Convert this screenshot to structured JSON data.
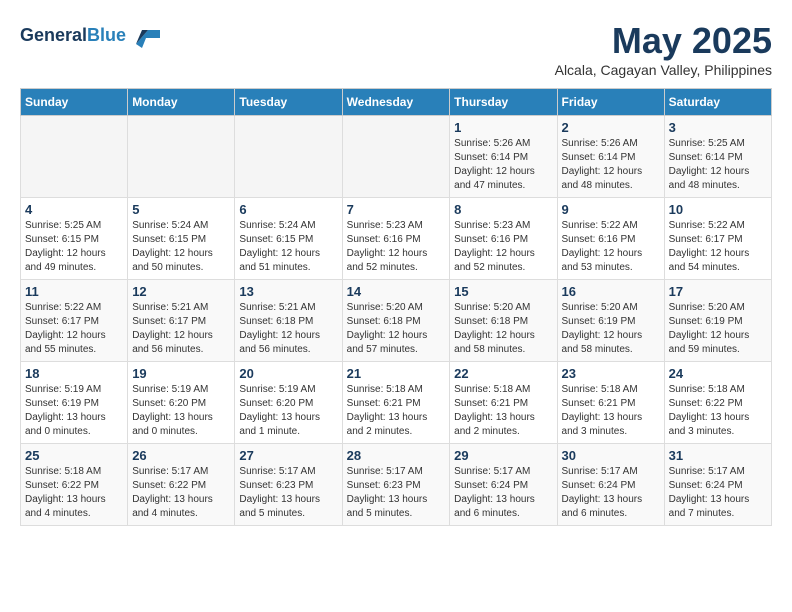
{
  "header": {
    "logo_line1": "General",
    "logo_line2": "Blue",
    "month": "May 2025",
    "location": "Alcala, Cagayan Valley, Philippines"
  },
  "weekdays": [
    "Sunday",
    "Monday",
    "Tuesday",
    "Wednesday",
    "Thursday",
    "Friday",
    "Saturday"
  ],
  "weeks": [
    [
      {
        "day": "",
        "info": ""
      },
      {
        "day": "",
        "info": ""
      },
      {
        "day": "",
        "info": ""
      },
      {
        "day": "",
        "info": ""
      },
      {
        "day": "1",
        "info": "Sunrise: 5:26 AM\nSunset: 6:14 PM\nDaylight: 12 hours\nand 47 minutes."
      },
      {
        "day": "2",
        "info": "Sunrise: 5:26 AM\nSunset: 6:14 PM\nDaylight: 12 hours\nand 48 minutes."
      },
      {
        "day": "3",
        "info": "Sunrise: 5:25 AM\nSunset: 6:14 PM\nDaylight: 12 hours\nand 48 minutes."
      }
    ],
    [
      {
        "day": "4",
        "info": "Sunrise: 5:25 AM\nSunset: 6:15 PM\nDaylight: 12 hours\nand 49 minutes."
      },
      {
        "day": "5",
        "info": "Sunrise: 5:24 AM\nSunset: 6:15 PM\nDaylight: 12 hours\nand 50 minutes."
      },
      {
        "day": "6",
        "info": "Sunrise: 5:24 AM\nSunset: 6:15 PM\nDaylight: 12 hours\nand 51 minutes."
      },
      {
        "day": "7",
        "info": "Sunrise: 5:23 AM\nSunset: 6:16 PM\nDaylight: 12 hours\nand 52 minutes."
      },
      {
        "day": "8",
        "info": "Sunrise: 5:23 AM\nSunset: 6:16 PM\nDaylight: 12 hours\nand 52 minutes."
      },
      {
        "day": "9",
        "info": "Sunrise: 5:22 AM\nSunset: 6:16 PM\nDaylight: 12 hours\nand 53 minutes."
      },
      {
        "day": "10",
        "info": "Sunrise: 5:22 AM\nSunset: 6:17 PM\nDaylight: 12 hours\nand 54 minutes."
      }
    ],
    [
      {
        "day": "11",
        "info": "Sunrise: 5:22 AM\nSunset: 6:17 PM\nDaylight: 12 hours\nand 55 minutes."
      },
      {
        "day": "12",
        "info": "Sunrise: 5:21 AM\nSunset: 6:17 PM\nDaylight: 12 hours\nand 56 minutes."
      },
      {
        "day": "13",
        "info": "Sunrise: 5:21 AM\nSunset: 6:18 PM\nDaylight: 12 hours\nand 56 minutes."
      },
      {
        "day": "14",
        "info": "Sunrise: 5:20 AM\nSunset: 6:18 PM\nDaylight: 12 hours\nand 57 minutes."
      },
      {
        "day": "15",
        "info": "Sunrise: 5:20 AM\nSunset: 6:18 PM\nDaylight: 12 hours\nand 58 minutes."
      },
      {
        "day": "16",
        "info": "Sunrise: 5:20 AM\nSunset: 6:19 PM\nDaylight: 12 hours\nand 58 minutes."
      },
      {
        "day": "17",
        "info": "Sunrise: 5:20 AM\nSunset: 6:19 PM\nDaylight: 12 hours\nand 59 minutes."
      }
    ],
    [
      {
        "day": "18",
        "info": "Sunrise: 5:19 AM\nSunset: 6:19 PM\nDaylight: 13 hours\nand 0 minutes."
      },
      {
        "day": "19",
        "info": "Sunrise: 5:19 AM\nSunset: 6:20 PM\nDaylight: 13 hours\nand 0 minutes."
      },
      {
        "day": "20",
        "info": "Sunrise: 5:19 AM\nSunset: 6:20 PM\nDaylight: 13 hours\nand 1 minute."
      },
      {
        "day": "21",
        "info": "Sunrise: 5:18 AM\nSunset: 6:21 PM\nDaylight: 13 hours\nand 2 minutes."
      },
      {
        "day": "22",
        "info": "Sunrise: 5:18 AM\nSunset: 6:21 PM\nDaylight: 13 hours\nand 2 minutes."
      },
      {
        "day": "23",
        "info": "Sunrise: 5:18 AM\nSunset: 6:21 PM\nDaylight: 13 hours\nand 3 minutes."
      },
      {
        "day": "24",
        "info": "Sunrise: 5:18 AM\nSunset: 6:22 PM\nDaylight: 13 hours\nand 3 minutes."
      }
    ],
    [
      {
        "day": "25",
        "info": "Sunrise: 5:18 AM\nSunset: 6:22 PM\nDaylight: 13 hours\nand 4 minutes."
      },
      {
        "day": "26",
        "info": "Sunrise: 5:17 AM\nSunset: 6:22 PM\nDaylight: 13 hours\nand 4 minutes."
      },
      {
        "day": "27",
        "info": "Sunrise: 5:17 AM\nSunset: 6:23 PM\nDaylight: 13 hours\nand 5 minutes."
      },
      {
        "day": "28",
        "info": "Sunrise: 5:17 AM\nSunset: 6:23 PM\nDaylight: 13 hours\nand 5 minutes."
      },
      {
        "day": "29",
        "info": "Sunrise: 5:17 AM\nSunset: 6:24 PM\nDaylight: 13 hours\nand 6 minutes."
      },
      {
        "day": "30",
        "info": "Sunrise: 5:17 AM\nSunset: 6:24 PM\nDaylight: 13 hours\nand 6 minutes."
      },
      {
        "day": "31",
        "info": "Sunrise: 5:17 AM\nSunset: 6:24 PM\nDaylight: 13 hours\nand 7 minutes."
      }
    ]
  ]
}
